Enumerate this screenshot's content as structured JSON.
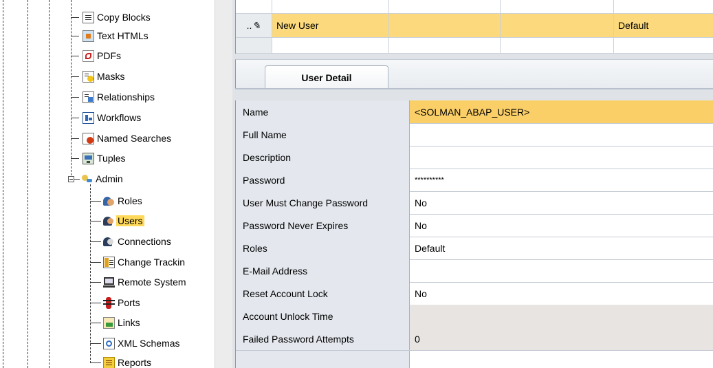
{
  "tree": {
    "items": [
      {
        "label": "Copy Blocks",
        "icon": "copy-blocks-icon"
      },
      {
        "label": "Text HTMLs",
        "icon": "text-html-icon"
      },
      {
        "label": "PDFs",
        "icon": "pdf-icon"
      },
      {
        "label": "Masks",
        "icon": "mask-icon"
      },
      {
        "label": "Relationships",
        "icon": "relationship-icon"
      },
      {
        "label": "Workflows",
        "icon": "workflow-icon"
      },
      {
        "label": "Named Searches",
        "icon": "named-search-icon"
      },
      {
        "label": "Tuples",
        "icon": "tuple-icon"
      },
      {
        "label": "Admin",
        "icon": "admin-icon"
      },
      {
        "label": "Roles",
        "icon": "roles-icon"
      },
      {
        "label": "Users",
        "icon": "users-icon"
      },
      {
        "label": "Connections",
        "icon": "connections-icon"
      },
      {
        "label": "Change Trackin",
        "icon": "change-tracking-icon"
      },
      {
        "label": "Remote System",
        "icon": "remote-system-icon"
      },
      {
        "label": "Ports",
        "icon": "ports-icon"
      },
      {
        "label": "Links",
        "icon": "links-icon"
      },
      {
        "label": "XML Schemas",
        "icon": "xml-schema-icon"
      },
      {
        "label": "Reports",
        "icon": "reports-icon"
      }
    ],
    "selected": "Users"
  },
  "grid": {
    "row": {
      "name": "New User",
      "roles": "Default"
    },
    "colors": {
      "selected_row": "#fbd97c"
    }
  },
  "tabs": {
    "user_detail": "User Detail"
  },
  "detail": {
    "rows": [
      {
        "label": "Name",
        "value": "<SOLMAN_ABAP_USER>"
      },
      {
        "label": "Full Name",
        "value": ""
      },
      {
        "label": "Description",
        "value": ""
      },
      {
        "label": "Password",
        "value": "**********"
      },
      {
        "label": "User Must Change Password",
        "value": "No"
      },
      {
        "label": "Password Never Expires",
        "value": "No"
      },
      {
        "label": "Roles",
        "value": "Default"
      },
      {
        "label": "E-Mail Address",
        "value": ""
      },
      {
        "label": "Reset Account Lock",
        "value": "No"
      },
      {
        "label": "Account Unlock Time",
        "value": ""
      },
      {
        "label": "Failed Password Attempts",
        "value": "0"
      }
    ]
  },
  "colors": {
    "highlight": "#fbcf68",
    "label_bg": "#e4e8ee",
    "disabled_bg": "#e7e4e2",
    "tree_selected": "#ffd95a"
  }
}
